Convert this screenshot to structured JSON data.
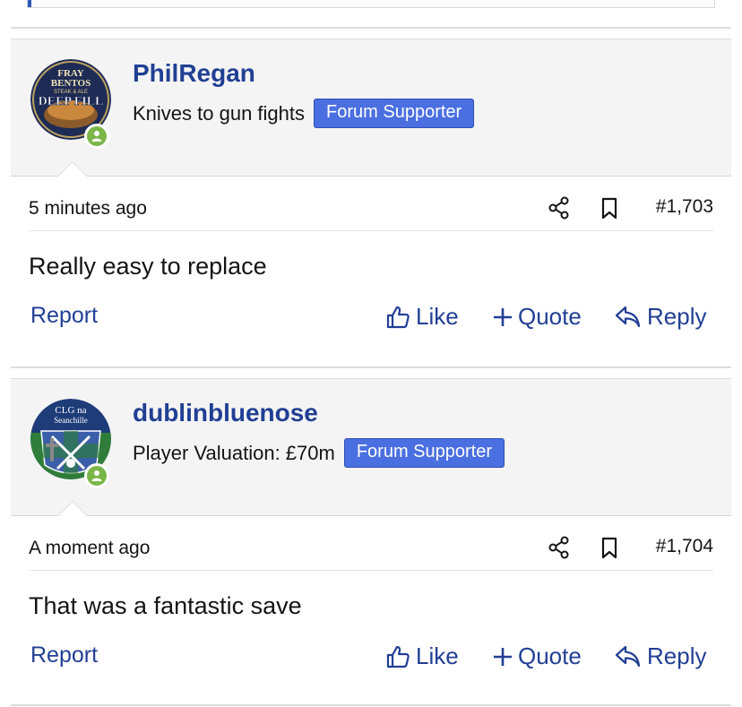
{
  "posts": [
    {
      "username": "PhilRegan",
      "user_title": "Knives to gun fights",
      "badge": "Forum Supporter",
      "time": "5 minutes ago",
      "post_number": "#1,703",
      "message": "Really easy to replace",
      "avatar_text": [
        "FRAY",
        "BENTOS",
        "STEAK & ALE",
        "DEEP FILL"
      ],
      "actions": {
        "report": "Report",
        "like": "Like",
        "quote": "Quote",
        "reply": "Reply"
      }
    },
    {
      "username": "dublinbluenose",
      "user_title": "Player Valuation: £70m",
      "badge": "Forum Supporter",
      "time": "A moment ago",
      "post_number": "#1,704",
      "message": "That was a fantastic save",
      "avatar_text": [
        "CLG na",
        "Seanchille"
      ],
      "actions": {
        "report": "Report",
        "like": "Like",
        "quote": "Quote",
        "reply": "Reply"
      }
    }
  ],
  "colors": {
    "link": "#213f94",
    "badge": "#4a6fe0",
    "online": "#7ab648",
    "header_bg": "#f4f4f4"
  },
  "icons": [
    "share-icon",
    "bookmark-icon",
    "thumbs-up-icon",
    "plus-icon",
    "reply-arrow-icon",
    "person-icon"
  ]
}
